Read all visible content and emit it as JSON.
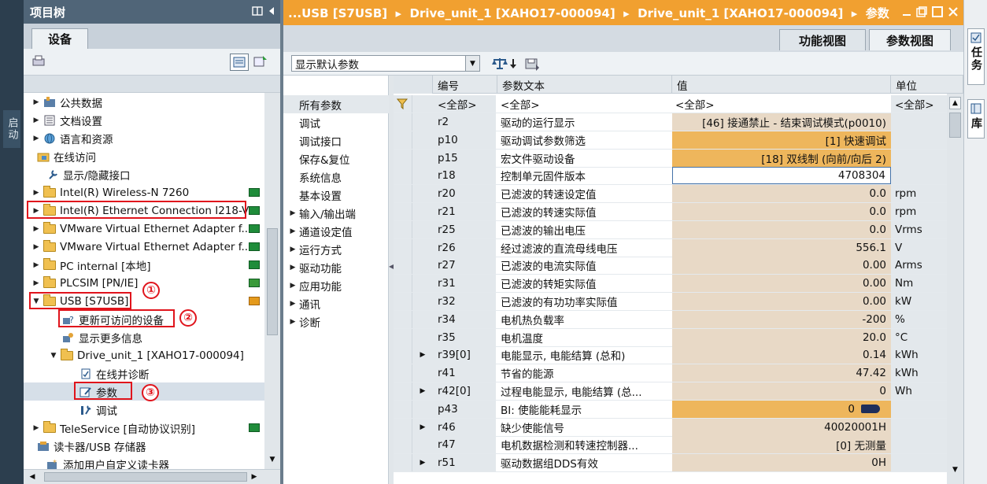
{
  "left_strip": {
    "label": "启动"
  },
  "project_tree": {
    "title": "项目树",
    "tab": "设备",
    "rows": [
      {
        "label": "公共数据"
      },
      {
        "label": "文档设置"
      },
      {
        "label": "语言和资源"
      },
      {
        "label": "在线访问"
      },
      {
        "label": "显示/隐藏接口"
      },
      {
        "label": "Intel(R) Wireless-N 7260"
      },
      {
        "label": "Intel(R) Ethernet Connection I218-V"
      },
      {
        "label": "VMware Virtual Ethernet Adapter f..."
      },
      {
        "label": "VMware Virtual Ethernet Adapter f..."
      },
      {
        "label": "PC internal [本地]"
      },
      {
        "label": "PLCSIM [PN/IE]"
      },
      {
        "label": "USB [S7USB]"
      },
      {
        "label": "更新可访问的设备"
      },
      {
        "label": "显示更多信息"
      },
      {
        "label": "Drive_unit_1 [XAHO17-000094]"
      },
      {
        "label": "在线并诊断"
      },
      {
        "label": "参数"
      },
      {
        "label": "调试"
      },
      {
        "label": "TeleService [自动协议识别]"
      },
      {
        "label": "读卡器/USB 存储器"
      },
      {
        "label": "添加用户自定义读卡器"
      }
    ],
    "annotations": [
      "①",
      "②",
      "③"
    ]
  },
  "editor": {
    "breadcrumb": "...USB [S7USB]  ▸  Drive_unit_1 [XAHO17-000094]  ▸  Drive_unit_1 [XAHO17-000094]  ▸  参数",
    "tab_function": "功能视图",
    "tab_param": "参数视图",
    "filter": "显示默认参数",
    "categories": [
      {
        "label": "所有参数",
        "expandable": false
      },
      {
        "label": "调试",
        "expandable": false
      },
      {
        "label": "调试接口",
        "expandable": false
      },
      {
        "label": "保存&复位",
        "expandable": false
      },
      {
        "label": "系统信息",
        "expandable": false
      },
      {
        "label": "基本设置",
        "expandable": false
      },
      {
        "label": "输入/输出端",
        "expandable": true
      },
      {
        "label": "通道设定值",
        "expandable": true
      },
      {
        "label": "运行方式",
        "expandable": true
      },
      {
        "label": "驱动功能",
        "expandable": true
      },
      {
        "label": "应用功能",
        "expandable": true
      },
      {
        "label": "通讯",
        "expandable": true
      },
      {
        "label": "诊断",
        "expandable": true
      }
    ],
    "columns": {
      "id": "编号",
      "text": "参数文本",
      "value": "值",
      "unit": "单位"
    },
    "filter_row": {
      "id": "<全部>",
      "text": "<全部>",
      "value": "<全部>",
      "unit": "<全部>"
    },
    "params": [
      {
        "id": "r2",
        "text": "驱动的运行显示",
        "value": "[46] 接通禁止 - 结束调试模式(p0010)",
        "unit": "",
        "style": "tan",
        "exp": false
      },
      {
        "id": "p10",
        "text": "驱动调试参数筛选",
        "value": "[1] 快速调试",
        "unit": "",
        "style": "org",
        "exp": false
      },
      {
        "id": "p15",
        "text": "宏文件驱动设备",
        "value": "[18] 双线制 (向前/向后 2)",
        "unit": "",
        "style": "org",
        "exp": false
      },
      {
        "id": "r18",
        "text": "控制单元固件版本",
        "value": "4708304",
        "unit": "",
        "style": "focus",
        "exp": false
      },
      {
        "id": "r20",
        "text": "已滤波的转速设定值",
        "value": "0.0",
        "unit": "rpm",
        "style": "tan",
        "exp": false
      },
      {
        "id": "r21",
        "text": "已滤波的转速实际值",
        "value": "0.0",
        "unit": "rpm",
        "style": "tan",
        "exp": false
      },
      {
        "id": "r25",
        "text": "已滤波的输出电压",
        "value": "0.0",
        "unit": "Vrms",
        "style": "tan",
        "exp": false
      },
      {
        "id": "r26",
        "text": "经过滤波的直流母线电压",
        "value": "556.1",
        "unit": "V",
        "style": "tan",
        "exp": false
      },
      {
        "id": "r27",
        "text": "已滤波的电流实际值",
        "value": "0.00",
        "unit": "Arms",
        "style": "tan",
        "exp": false
      },
      {
        "id": "r31",
        "text": "已滤波的转矩实际值",
        "value": "0.00",
        "unit": "Nm",
        "style": "tan",
        "exp": false
      },
      {
        "id": "r32",
        "text": "已滤波的有功功率实际值",
        "value": "0.00",
        "unit": "kW",
        "style": "tan",
        "exp": false
      },
      {
        "id": "r34",
        "text": "电机热负载率",
        "value": "-200",
        "unit": "%",
        "style": "tan",
        "exp": false
      },
      {
        "id": "r35",
        "text": "电机温度",
        "value": "20.0",
        "unit": "°C",
        "style": "tan",
        "exp": false
      },
      {
        "id": "r39[0]",
        "text": "电能显示, 电能结算 (总和)",
        "value": "0.14",
        "unit": "kWh",
        "style": "tan",
        "exp": true
      },
      {
        "id": "r41",
        "text": "节省的能源",
        "value": "47.42",
        "unit": "kWh",
        "style": "tan",
        "exp": false
      },
      {
        "id": "r42[0]",
        "text": "过程电能显示, 电能结算 (总...",
        "value": "0",
        "unit": "Wh",
        "style": "tan",
        "exp": true
      },
      {
        "id": "p43",
        "text": "BI: 使能能耗显示",
        "value": "0",
        "unit": "",
        "style": "org",
        "exp": false
      },
      {
        "id": "r46",
        "text": "缺少使能信号",
        "value": "40020001H",
        "unit": "",
        "style": "tan",
        "exp": true
      },
      {
        "id": "r47",
        "text": "电机数据检测和转速控制器...",
        "value": "[0] 无测量",
        "unit": "",
        "style": "tan",
        "exp": false
      },
      {
        "id": "r51",
        "text": "驱动数据组DDS有效",
        "value": "0H",
        "unit": "",
        "style": "tan",
        "exp": true
      }
    ]
  },
  "right_strip": {
    "tab1": "任务",
    "tab2": "库"
  },
  "colors": {
    "title_orange": "#f1a030",
    "tree_header": "#506578",
    "value_tan": "#e8d9c6",
    "value_orange": "#eeb65c",
    "annotation_red": "#e0141c"
  }
}
